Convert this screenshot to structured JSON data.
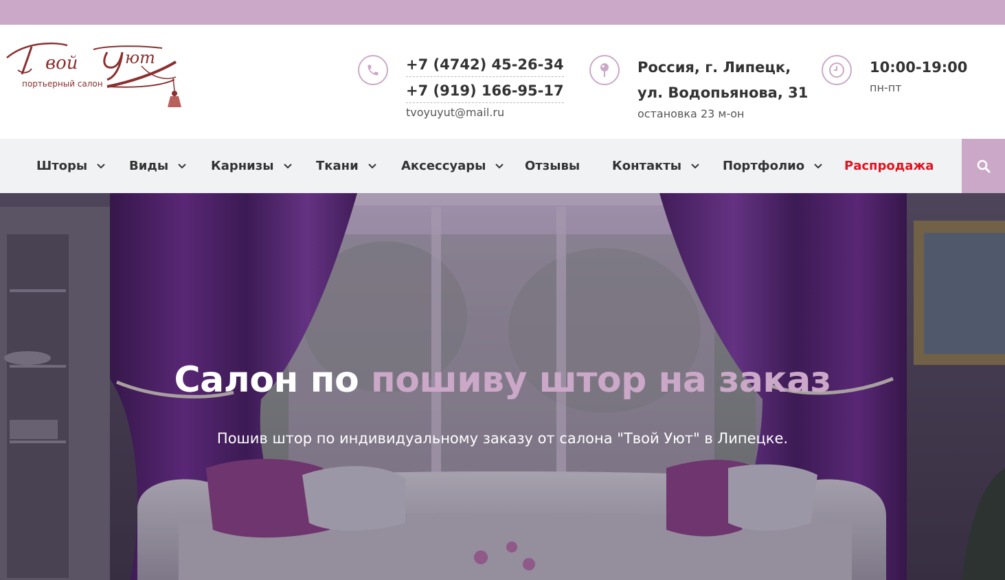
{
  "brand": {
    "logo_script": "Твой Уют",
    "logo_tagline": "портьерный салон",
    "accent_color": "#cba8c8",
    "sale_color": "#e2131e"
  },
  "contacts": {
    "phone_icon": "phone-icon",
    "phone_1": "+7 (4742) 45-26-34",
    "phone_2": "+7 (919) 166-95-17",
    "email": "tvoyuyut@mail.ru"
  },
  "address": {
    "icon": "map-pin-icon",
    "line_1": "Россия, г. Липецк,",
    "line_2": "ул. Водопьянова, 31",
    "note": "остановка 23 м-он"
  },
  "hours": {
    "icon": "clock-icon",
    "time": "10:00-19:00",
    "days": "пн-пт"
  },
  "nav": {
    "items": [
      {
        "label": "Шторы",
        "has_dropdown": true
      },
      {
        "label": "Виды",
        "has_dropdown": true
      },
      {
        "label": "Карнизы",
        "has_dropdown": true
      },
      {
        "label": "Ткани",
        "has_dropdown": true
      },
      {
        "label": "Аксессуары",
        "has_dropdown": true
      },
      {
        "label": "Отзывы",
        "has_dropdown": false
      },
      {
        "label": "Контакты",
        "has_dropdown": true
      },
      {
        "label": "Портфолио",
        "has_dropdown": true
      },
      {
        "label": "Распродажа",
        "has_dropdown": false
      }
    ],
    "search_icon": "search-icon"
  },
  "hero": {
    "title_plain": "Салон по ",
    "title_accent": "пошиву штор на заказ",
    "subtitle": "Пошив штор по индивидуальному заказу от салона \"Твой Уют\" в Липецке."
  }
}
